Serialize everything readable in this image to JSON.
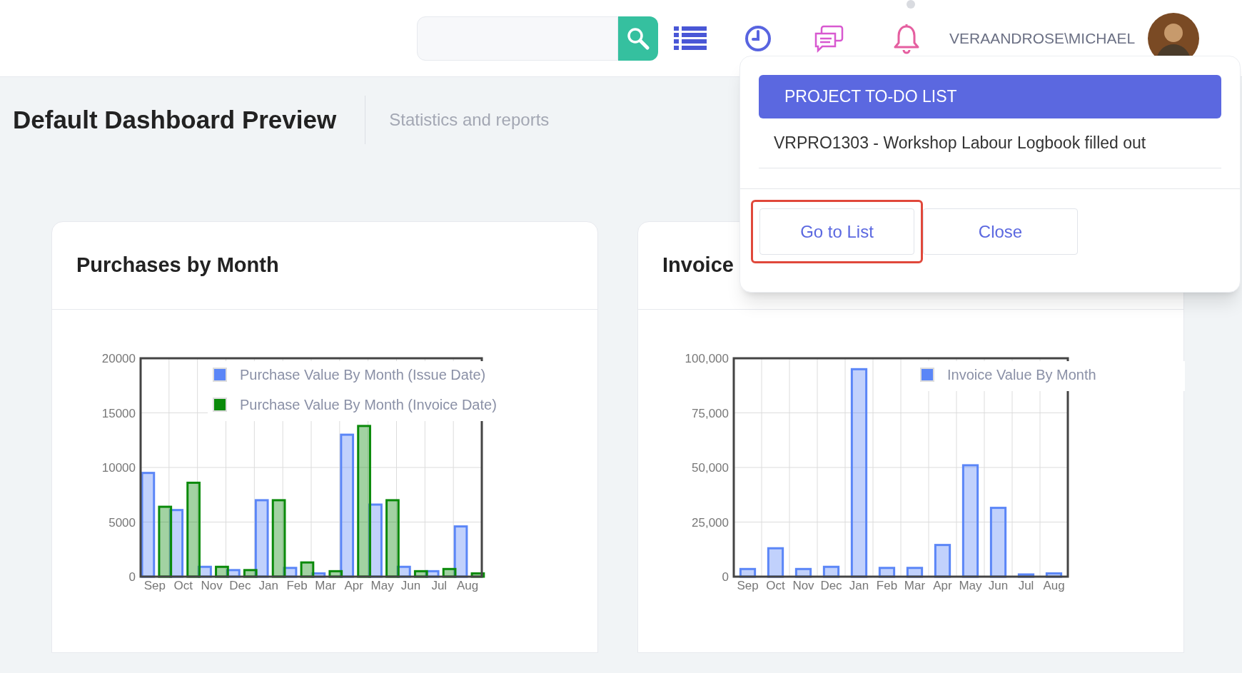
{
  "topbar": {
    "username": "VERAANDROSE\\MICHAEL",
    "notification_dot": true
  },
  "header": {
    "title": "Default Dashboard Preview",
    "subtitle": "Statistics and reports"
  },
  "cards": [
    {
      "title": "Purchases by Month",
      "chart_data": {
        "type": "bar",
        "categories": [
          "Sep",
          "Oct",
          "Nov",
          "Dec",
          "Jan",
          "Feb",
          "Mar",
          "Apr",
          "May",
          "Jun",
          "Jul",
          "Aug"
        ],
        "grid": true,
        "legend": true,
        "ylim": [
          0,
          20000
        ],
        "yticks": [
          0,
          5000,
          10000,
          15000,
          20000
        ],
        "series": [
          {
            "name": "Purchase Value By Month (Issue Date)",
            "color": "#5b86f7",
            "values": [
              9500,
              6100,
              900,
              600,
              7000,
              800,
              300,
              13000,
              6600,
              900,
              500,
              4600
            ]
          },
          {
            "name": "Purchase Value By Month (Invoice Date)",
            "color": "#0a8a0a",
            "values": [
              6400,
              8600,
              900,
              600,
              7000,
              1300,
              500,
              13800,
              7000,
              500,
              700,
              300
            ]
          }
        ]
      }
    },
    {
      "title": "Invoice",
      "chart_data": {
        "type": "bar",
        "categories": [
          "Sep",
          "Oct",
          "Nov",
          "Dec",
          "Jan",
          "Feb",
          "Mar",
          "Apr",
          "May",
          "Jun",
          "Jul",
          "Aug"
        ],
        "grid": true,
        "legend": true,
        "ylim": [
          0,
          100000
        ],
        "yticks": [
          {
            "value": 0,
            "label": "0"
          },
          {
            "value": 25000,
            "label": "25,000"
          },
          {
            "value": 50000,
            "label": "50,000"
          },
          {
            "value": 75000,
            "label": "75,000"
          },
          {
            "value": 100000,
            "label": "100,000"
          }
        ],
        "series": [
          {
            "name": "Invoice Value By Month",
            "color": "#5b86f7",
            "values": [
              3500,
              13000,
              3500,
              4500,
              95000,
              4000,
              4000,
              14500,
              51000,
              31500,
              1000,
              1500
            ]
          }
        ]
      }
    }
  ],
  "popup": {
    "header": "PROJECT TO-DO LIST",
    "items": [
      "VRPRO1303 - Workshop Labour Logbook filled out"
    ],
    "buttons": [
      {
        "label": "Go to List",
        "highlighted": true
      },
      {
        "label": "Close",
        "highlighted": false
      }
    ]
  }
}
